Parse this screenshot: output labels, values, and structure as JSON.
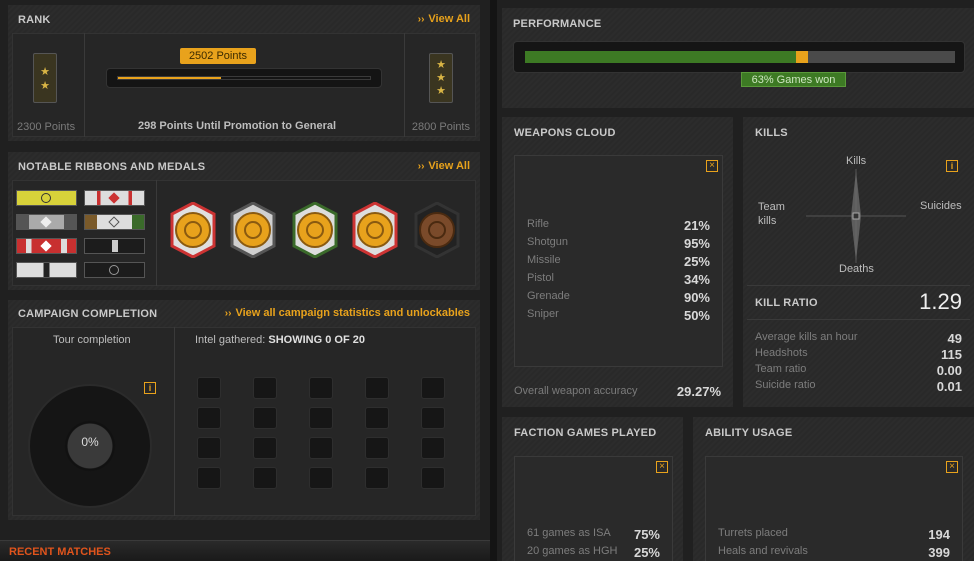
{
  "rank": {
    "title": "RANK",
    "view_all": "View All",
    "current_points_badge": "2502 Points",
    "progress_fraction": 0.41,
    "left_points": "2300 Points",
    "right_points": "2800 Points",
    "promotion_text": "298 Points Until Promotion to General"
  },
  "ribbons": {
    "title": "NOTABLE RIBBONS AND MEDALS",
    "view_all": "View All"
  },
  "campaign": {
    "title": "CAMPAIGN COMPLETION",
    "link": "View all campaign statistics and unlockables",
    "tour_label": "Tour completion",
    "tour_percent": "0%",
    "intel_label": "Intel gathered:",
    "intel_value": "SHOWING 0 OF 20"
  },
  "recent": {
    "title": "RECENT MATCHES"
  },
  "performance": {
    "title": "PERFORMANCE",
    "won_fraction": 0.63,
    "won_text": "63% Games won"
  },
  "weapons": {
    "title": "WEAPONS CLOUD",
    "items": [
      {
        "label": "Rifle",
        "value": "21%"
      },
      {
        "label": "Shotgun",
        "value": "95%"
      },
      {
        "label": "Missile",
        "value": "25%"
      },
      {
        "label": "Pistol",
        "value": "34%"
      },
      {
        "label": "Grenade",
        "value": "90%"
      },
      {
        "label": "Sniper",
        "value": "50%"
      }
    ],
    "accuracy_label": "Overall weapon accuracy",
    "accuracy_value": "29.27%"
  },
  "kills": {
    "title": "KILLS",
    "axis_top": "Kills",
    "axis_left": "Team\nkills",
    "axis_right": "Suicides",
    "axis_bottom": "Deaths",
    "ratio_label": "KILL RATIO",
    "ratio_value": "1.29",
    "stats": [
      {
        "label": "Average kills an hour",
        "value": "49"
      },
      {
        "label": "Headshots",
        "value": "115"
      },
      {
        "label": "Team ratio",
        "value": "0.00"
      },
      {
        "label": "Suicide ratio",
        "value": "0.01"
      }
    ]
  },
  "faction": {
    "title": "FACTION GAMES PLAYED",
    "items": [
      {
        "label": "61 games as ISA",
        "value": "75%"
      },
      {
        "label": "20 games as HGH",
        "value": "25%"
      }
    ]
  },
  "ability": {
    "title": "ABILITY USAGE",
    "items": [
      {
        "label": "Turrets placed",
        "value": "194"
      },
      {
        "label": "Heals and revivals",
        "value": "399"
      }
    ]
  },
  "colors": {
    "accent": "#e8a21c",
    "green": "#3d7a24"
  }
}
